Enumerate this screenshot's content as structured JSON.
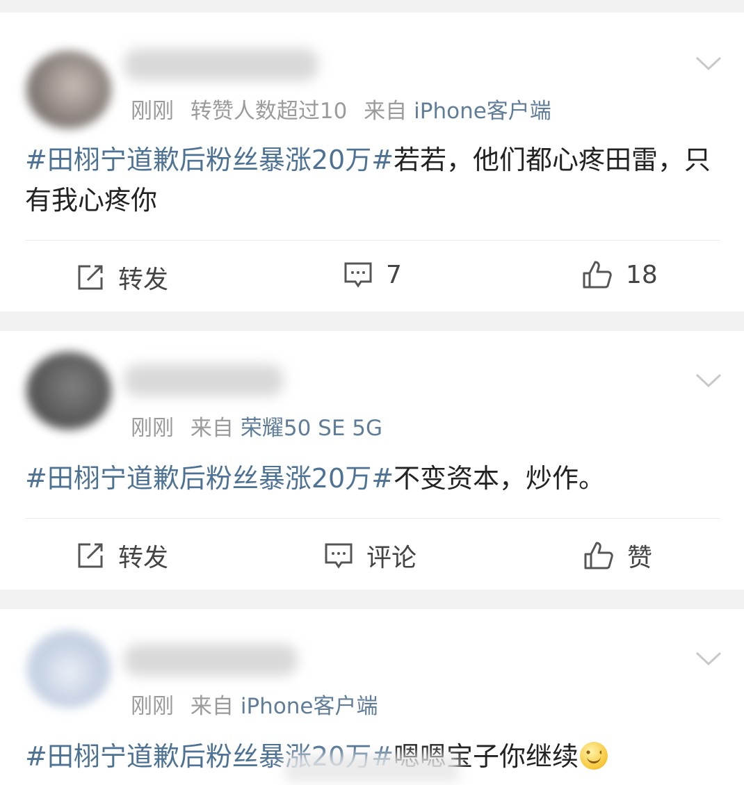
{
  "posts": [
    {
      "meta": [
        "刚刚",
        "转赞人数超过10",
        "来自"
      ],
      "source": "iPhone客户端",
      "hashtag": "#田栩宁道歉后粉丝暴涨20万#",
      "text": "若若，他们都心疼田雷，只有我心疼你",
      "actions": {
        "repost": "转发",
        "comment": "7",
        "like": "18"
      }
    },
    {
      "meta": [
        "刚刚",
        "来自"
      ],
      "source": "荣耀50 SE 5G",
      "hashtag": "#田栩宁道歉后粉丝暴涨20万#",
      "text": "不变资本，炒作。",
      "actions": {
        "repost": "转发",
        "comment": "评论",
        "like": "赞"
      }
    },
    {
      "meta": [
        "刚刚",
        "来自"
      ],
      "source": "iPhone客户端",
      "hashtag": "#田栩宁道歉后粉丝暴涨20万#",
      "text": "嗯嗯宝子你继续",
      "emoji": "smiling-face-emoji"
    }
  ],
  "icons": {
    "menu": "chevron-down-icon",
    "repost": "share-edit-icon",
    "comment": "comment-bubble-icon",
    "like": "thumbs-up-icon"
  },
  "colors": {
    "hashtag": "#4e7293",
    "source": "#5f7d98",
    "meta": "#9b9b9b",
    "separator": "#f2f2f2"
  }
}
